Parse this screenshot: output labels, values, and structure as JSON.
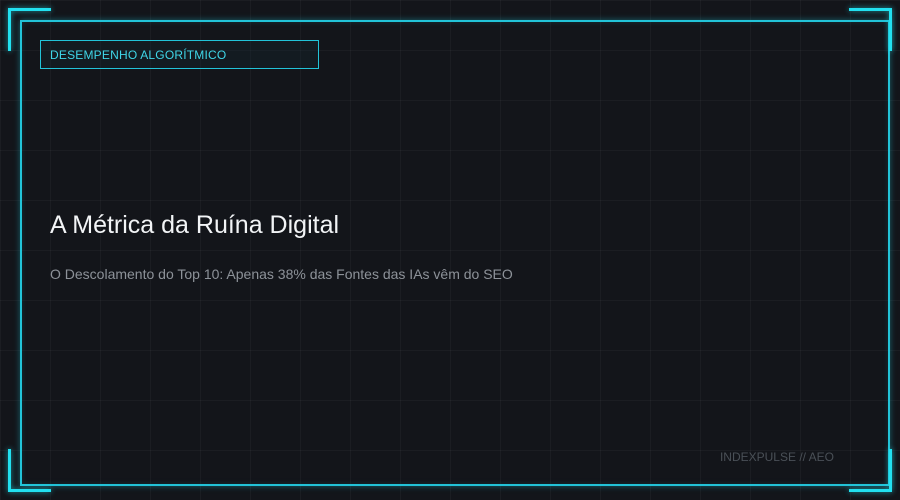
{
  "theme": {
    "background": "#13151a",
    "accent": "#22c3d8",
    "title_color": "#f2f4f6",
    "subtitle_color": "#8d9299"
  },
  "header": {
    "tag_label": "DESEMPENHO ALGORÍTMICO"
  },
  "main": {
    "title": "A Métrica da Ruína Digital",
    "subtitle": "O Descolamento do Top 10: Apenas 38% das Fontes das IAs vêm do SEO"
  },
  "footer": {
    "brand": "INDEXPULSE // AEO"
  }
}
